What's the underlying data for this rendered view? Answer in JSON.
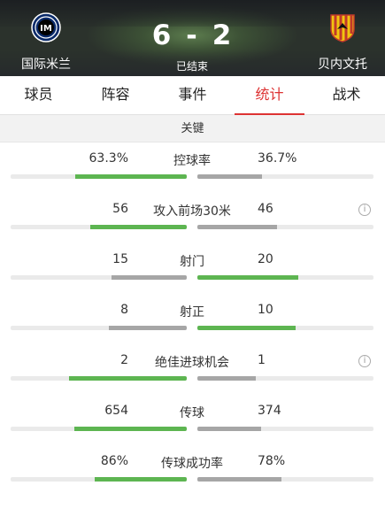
{
  "match": {
    "home_team": "国际米兰",
    "away_team": "贝内文托",
    "home_score": "6",
    "away_score": "2",
    "score_separator": "-",
    "status": "已结束"
  },
  "tabs": [
    {
      "label": "球员"
    },
    {
      "label": "阵容"
    },
    {
      "label": "事件"
    },
    {
      "label": "统计"
    },
    {
      "label": "战术"
    }
  ],
  "active_tab": "统计",
  "section": {
    "title": "关键"
  },
  "stats": [
    {
      "label": "控球率",
      "left": "63.3%",
      "right": "36.7%",
      "left_fraction": 0.633,
      "right_fraction": 0.367,
      "winner": "left",
      "info": false
    },
    {
      "label": "攻入前场30米",
      "left": "56",
      "right": "46",
      "left_fraction": 0.549,
      "right_fraction": 0.451,
      "winner": "left",
      "info": true
    },
    {
      "label": "射门",
      "left": "15",
      "right": "20",
      "left_fraction": 0.429,
      "right_fraction": 0.571,
      "winner": "right",
      "info": false
    },
    {
      "label": "射正",
      "left": "8",
      "right": "10",
      "left_fraction": 0.444,
      "right_fraction": 0.556,
      "winner": "right",
      "info": false
    },
    {
      "label": "绝佳进球机会",
      "left": "2",
      "right": "1",
      "left_fraction": 0.667,
      "right_fraction": 0.333,
      "winner": "left",
      "info": true
    },
    {
      "label": "传球",
      "left": "654",
      "right": "374",
      "left_fraction": 0.636,
      "right_fraction": 0.364,
      "winner": "left",
      "info": false
    },
    {
      "label": "传球成功率",
      "left": "86%",
      "right": "78%",
      "left_fraction": 0.525,
      "right_fraction": 0.475,
      "winner": "left",
      "info": false
    }
  ],
  "info_glyph": "i",
  "colors": {
    "accent": "#dd3333",
    "bar_win": "#5db551",
    "bar_lose": "#a6a6a6",
    "bar_track": "#eaeaea"
  },
  "icons": {
    "home_logo": "inter-milan-crest-icon",
    "away_logo": "benevento-crest-icon",
    "info": "info-circle-icon"
  }
}
